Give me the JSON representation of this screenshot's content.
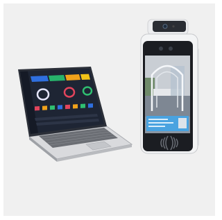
{
  "scene": {
    "background_color": "#f0f0f0",
    "objects": [
      {
        "name": "laptop",
        "icon": "laptop-icon",
        "screen_content": "dashboard"
      },
      {
        "name": "face-recognition-terminal",
        "icon": "tablet-terminal-icon",
        "screen_content": "camera-view"
      }
    ],
    "dashboard_card_colors": [
      "#2f6fdf",
      "#27b36b",
      "#f0a21b",
      "#f2c318"
    ],
    "dashboard_ring_colors": [
      "#e6e6ff",
      "#e2445c",
      "#2fbf71"
    ],
    "dashboard_tile_colors": [
      "#e2445c",
      "#f0a21b",
      "#2fbf71",
      "#2f6fdf",
      "#e2445c",
      "#f0a21b",
      "#2fbf71",
      "#2f6fdf"
    ],
    "terminal_panel_color": "#4aa3e0"
  }
}
